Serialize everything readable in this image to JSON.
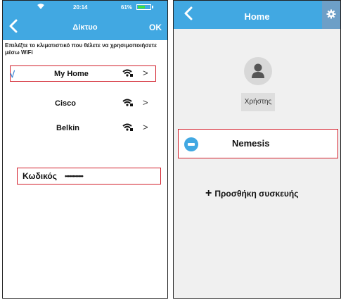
{
  "left_screen": {
    "status": {
      "time": "20:14",
      "battery": "61%",
      "battery_level": 0.61
    },
    "nav": {
      "title": "Δίκτυο",
      "ok_label": "OK"
    },
    "hint": "Επιλέξτε το κλιματιστικό που θέλετε να χρησιμοποιήσετε μέσω WiFi",
    "networks": [
      {
        "name": "My Home",
        "selected": true,
        "check": "√",
        "chevron": ">"
      },
      {
        "name": "Cisco",
        "selected": false,
        "chevron": ">"
      },
      {
        "name": "Belkin",
        "selected": false,
        "chevron": ">"
      }
    ],
    "password": {
      "label": "Κωδικός",
      "value": "••••••••••••"
    }
  },
  "right_screen": {
    "nav": {
      "title": "Home"
    },
    "user": {
      "label": "Χρήστης"
    },
    "device": {
      "name": "Nemesis"
    },
    "add_device": {
      "plus": "+",
      "label": "Προσθήκη συσκευής"
    }
  },
  "colors": {
    "header": "#41a8e2",
    "highlight": "#d21f2b",
    "settings_box": "#6d9fc7"
  },
  "icons": [
    "wifi-icon",
    "back-icon",
    "settings-gear-icon",
    "user-icon",
    "air-conditioner-icon",
    "wifi-lock-icon",
    "chevron-right-icon",
    "checkmark-icon"
  ]
}
